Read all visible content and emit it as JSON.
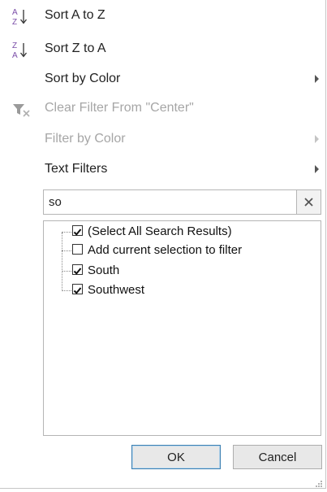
{
  "menu": {
    "items": [
      {
        "label": "Sort A to Z",
        "icon": "sort-az-icon",
        "enabled": true,
        "submenu": false
      },
      {
        "label": "Sort Z to A",
        "icon": "sort-za-icon",
        "enabled": true,
        "submenu": false
      },
      {
        "label": "Sort by Color",
        "icon": "",
        "enabled": true,
        "submenu": true
      },
      {
        "label": "Clear Filter From \"Center\"",
        "icon": "clear-filter-icon",
        "enabled": false,
        "submenu": false
      },
      {
        "label": "Filter by Color",
        "icon": "",
        "enabled": false,
        "submenu": true
      },
      {
        "label": "Text Filters",
        "icon": "",
        "enabled": true,
        "submenu": true
      }
    ]
  },
  "search": {
    "value": "so",
    "clear_icon": "close-icon"
  },
  "results": {
    "items": [
      {
        "label": "(Select All Search Results)",
        "checked": true
      },
      {
        "label": "Add current selection to filter",
        "checked": false
      },
      {
        "label": "South",
        "checked": true
      },
      {
        "label": "Southwest",
        "checked": true
      }
    ]
  },
  "buttons": {
    "ok_label": "OK",
    "cancel_label": "Cancel"
  },
  "colors": {
    "accent_blue": "#3c7fb1",
    "icon_purple": "#7b4ea8",
    "disabled_text": "#a6a6a6"
  }
}
